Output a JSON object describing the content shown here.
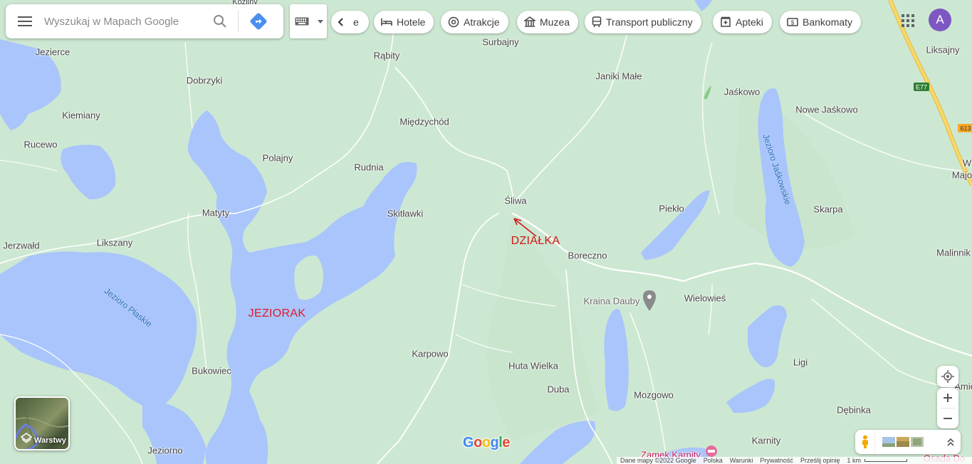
{
  "search": {
    "placeholder": "Wyszukaj w Mapach Google"
  },
  "icons": {
    "menu": "hamburger-menu-icon",
    "search": "magnifier-icon",
    "directions": "directions-diamond-icon",
    "keyboard": "keyboard-icon",
    "dropdown": "caret-down-icon",
    "prev": "chevron-left-icon",
    "apps": "grid-apps-icon",
    "locate": "my-location-icon",
    "zoom_in": "plus-icon",
    "zoom_out": "minus-icon",
    "pegman": "pegman-icon",
    "expand": "chevrons-up-icon",
    "poi": "pin-icon",
    "hotel_poi": "hotel-bed-icon"
  },
  "chips": {
    "prev_partial": "e",
    "items": [
      {
        "label": "Hotele",
        "icon": "bed-icon"
      },
      {
        "label": "Atrakcje",
        "icon": "camera-icon"
      },
      {
        "label": "Muzea",
        "icon": "museum-icon"
      },
      {
        "label": "Transport publiczny",
        "icon": "train-icon"
      },
      {
        "label": "Apteki",
        "icon": "pharmacy-icon"
      },
      {
        "label": "Bankomaty",
        "icon": "atm-icon"
      }
    ]
  },
  "account": {
    "avatar_letter": "A"
  },
  "layers": {
    "label": "Warstwy"
  },
  "places": [
    {
      "name": "Jezierce"
    },
    {
      "name": "Dobrzyki"
    },
    {
      "name": "Kiemiany"
    },
    {
      "name": "Rucewo"
    },
    {
      "name": "Rąbity"
    },
    {
      "name": "Surbajny"
    },
    {
      "name": "Janiki Małe"
    },
    {
      "name": "Jaśkowo"
    },
    {
      "name": "Nowe Jaśkowo"
    },
    {
      "name": "Liksajny"
    },
    {
      "name": "Międzychód"
    },
    {
      "name": "Polajny"
    },
    {
      "name": "Rudnia"
    },
    {
      "name": "Śliwa"
    },
    {
      "name": "Matyty"
    },
    {
      "name": "Skitławki"
    },
    {
      "name": "Piekło"
    },
    {
      "name": "Skarpa"
    },
    {
      "name": "W"
    },
    {
      "name": "Majo"
    },
    {
      "name": "Jerzwałd"
    },
    {
      "name": "Likszany"
    },
    {
      "name": "Boreczno"
    },
    {
      "name": "Malinnik"
    },
    {
      "name": "Kraina Dauby"
    },
    {
      "name": "Wielowieś"
    },
    {
      "name": "Karpowo"
    },
    {
      "name": "Ligi"
    },
    {
      "name": "Bukowiec"
    },
    {
      "name": "Huta Wielka"
    },
    {
      "name": "Duba"
    },
    {
      "name": "Mozgowo"
    },
    {
      "name": "Dębinka"
    },
    {
      "name": "Karnity"
    },
    {
      "name": "Jeziorno"
    },
    {
      "name": "Zamek Karnity"
    },
    {
      "name": "Osada Do"
    },
    {
      "name": "Kozliny"
    },
    {
      "name": "Amie"
    }
  ],
  "lakes": [
    {
      "name": "Jezioro Płaskie"
    },
    {
      "name": "Jezioro Jaśkowskie"
    }
  ],
  "road_shields": [
    {
      "label": "E77",
      "color": "#2e7d32"
    },
    {
      "label": "613",
      "color": "#f9a825"
    }
  ],
  "annotations": [
    {
      "text": "JEZIORAK",
      "color": "#e0192a"
    },
    {
      "text": "DZIAŁKA",
      "color": "#d01818"
    }
  ],
  "google_logo": "Google",
  "footer": {
    "items": [
      "Dane mapy ©2022 Google",
      "Polska",
      "Warunki",
      "Prywatność",
      "Prześlij opinię",
      "1 km"
    ]
  },
  "colors": {
    "land": "#cde8d2",
    "water": "#a9c5fb",
    "road": "#ffffff",
    "highway": "#f7d86c",
    "annotation": "#d01818",
    "avatar": "#7e57c2"
  }
}
